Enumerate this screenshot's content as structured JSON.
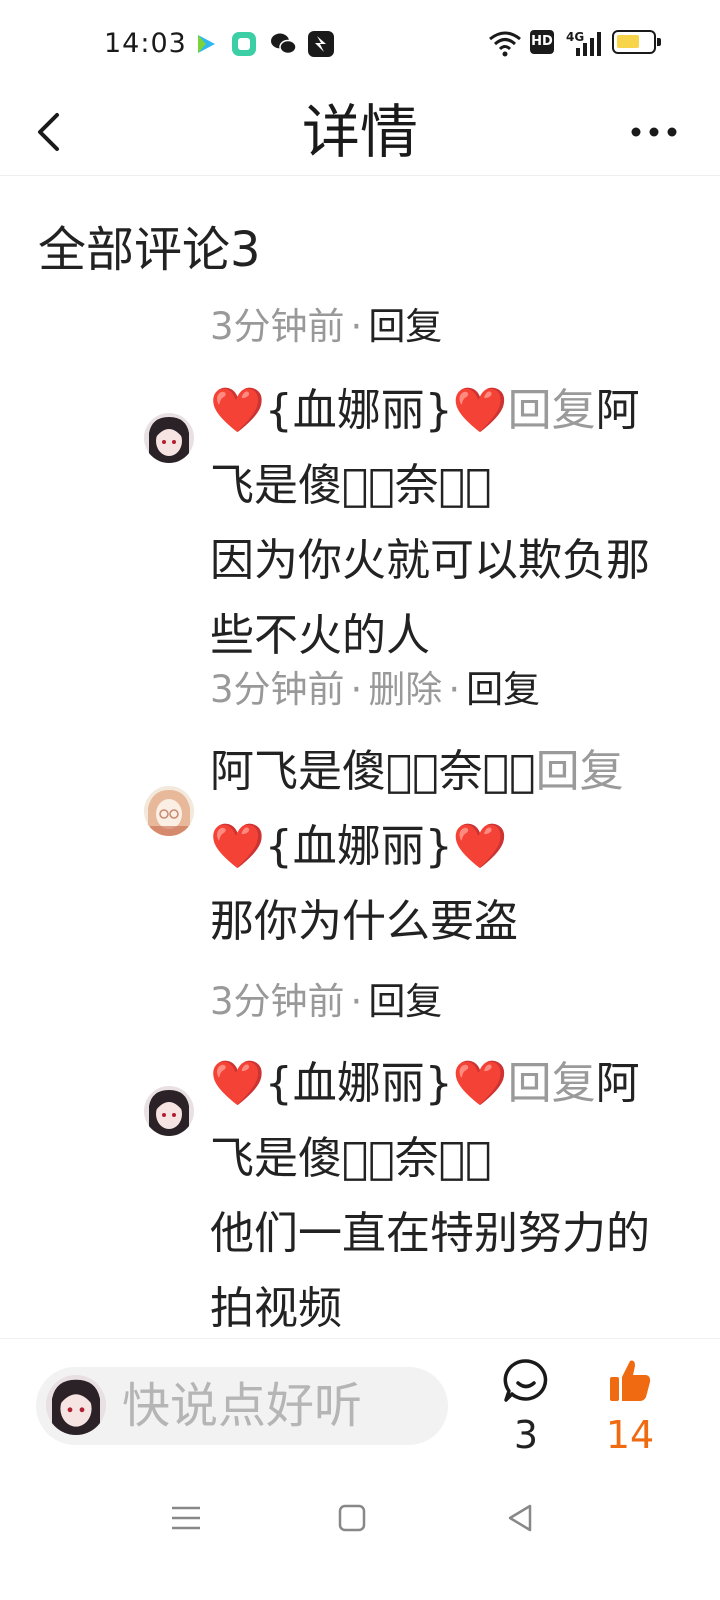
{
  "status_bar": {
    "time": "14:03",
    "network": "4G",
    "hd": "HD"
  },
  "header": {
    "title": "详情"
  },
  "comments_section": {
    "title": "全部评论3"
  },
  "comments": [
    {
      "time": "3分钟前",
      "reply_label": "回复",
      "heart_left": "❤️",
      "user": "{血娜丽}",
      "heart_right": "❤️",
      "reply_word": "回复",
      "target": "阿飞是傻龟᷂奈团᷂",
      "text": "因为你火就可以欺负那些不火的人"
    },
    {
      "time": "3分钟前",
      "delete_label": "删除",
      "reply_label": "回复",
      "user": "阿飞是傻龟᷂奈团᷂",
      "reply_word": "回复",
      "heart_left": "❤️",
      "target": "{血娜丽}",
      "heart_right": "❤️",
      "text": "那你为什么要盗"
    },
    {
      "time": "3分钟前",
      "reply_label": "回复",
      "heart_left": "❤️",
      "user": "{血娜丽}",
      "heart_right": "❤️",
      "reply_word": "回复",
      "target": "阿飞是傻龟᷂奈团᷂",
      "text": "他们一直在特别努力的拍视频"
    }
  ],
  "bottom_bar": {
    "input_placeholder": "快说点好听",
    "comment_count": "3",
    "like_count": "14"
  },
  "colors": {
    "accent_orange": "#f06a12",
    "heart_red": "#e0202a",
    "meta_gray": "#999999"
  },
  "icons": [
    "back-icon",
    "more-icon",
    "comment-icon",
    "like-icon",
    "menu-icon",
    "home-icon",
    "back-triangle-icon"
  ]
}
